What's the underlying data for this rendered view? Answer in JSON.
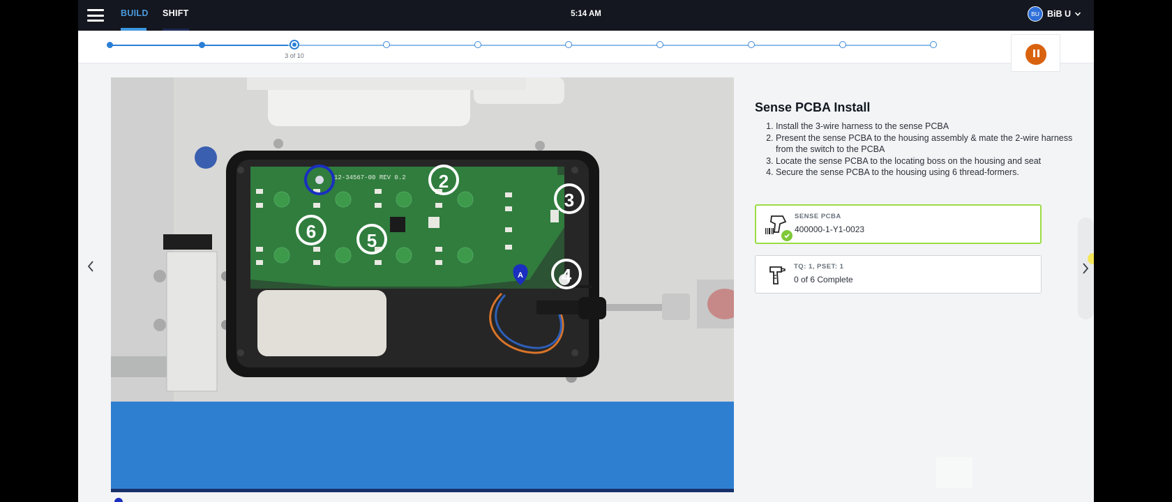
{
  "topbar": {
    "tabs": [
      {
        "label": "BUILD",
        "active": true
      },
      {
        "label": "SHIFT",
        "active": false
      }
    ],
    "time": "5:14 AM",
    "user": {
      "initials": "BU",
      "name": "BiB U"
    }
  },
  "stepper": {
    "current": 3,
    "total": 10,
    "count_label": "3 of 10",
    "pause_icon": "pause-icon"
  },
  "photo": {
    "board_label": "12-34567-00 REV 0.2",
    "markers": [
      "2",
      "3",
      "4",
      "5",
      "6"
    ],
    "anchor_label": "A"
  },
  "instructions": {
    "title": "Sense PCBA Install",
    "steps": [
      "Install the 3-wire harness to the sense PCBA",
      "Present the sense PCBA to the housing assembly & mate the 2-wire harness from the switch to the PCBA",
      "Locate the sense PCBA to the locating boss on the housing and seat",
      "Secure the sense PCBA to the housing using 6 thread-formers."
    ]
  },
  "cards": {
    "scan": {
      "label": "SENSE PCBA",
      "value": "400000-1-Y1-0023",
      "icon": "barcode-scanner-icon",
      "status": "complete"
    },
    "torque": {
      "label": "TQ: 1, PSET: 1",
      "value": "0 of 6 Complete",
      "icon": "torque-driver-icon"
    }
  },
  "colors": {
    "topbar": "#14171f",
    "accent": "#2a7fd4",
    "pause": "#d9620f",
    "scan_border": "#9bdc45",
    "marker_blue": "#1a2fc0"
  }
}
